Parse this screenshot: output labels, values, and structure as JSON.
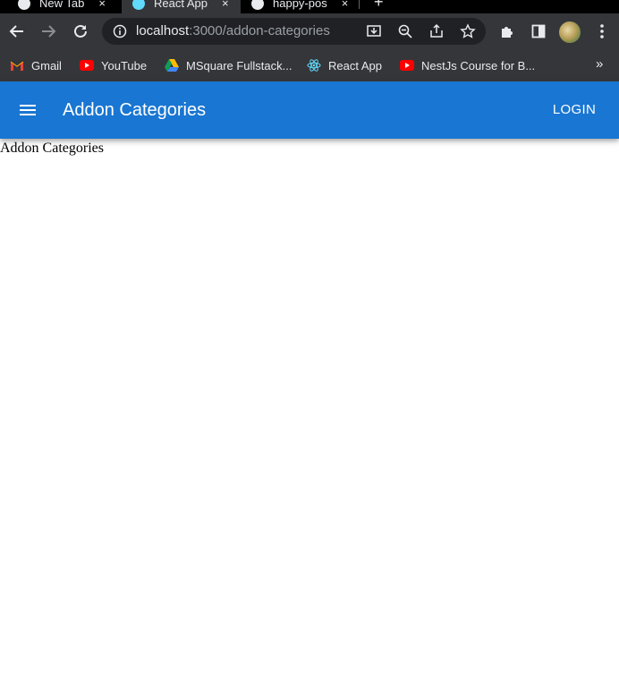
{
  "browser": {
    "tabs": [
      {
        "label": "New Tab",
        "icon": "github-icon",
        "close": "×"
      },
      {
        "label": "React App",
        "icon": "react-icon",
        "close": "×"
      },
      {
        "label": "happy-pos",
        "icon": "github-icon",
        "close": "×"
      }
    ],
    "new_tab": "+",
    "address": {
      "host": "localhost",
      "path": ":3000/addon-categories"
    },
    "bookmarks": [
      {
        "label": "Gmail",
        "icon": "gmail-icon"
      },
      {
        "label": "YouTube",
        "icon": "youtube-icon"
      },
      {
        "label": "MSquare Fullstack...",
        "icon": "google-drive-icon"
      },
      {
        "label": "React App",
        "icon": "react-icon"
      },
      {
        "label": "NestJs Course for B...",
        "icon": "youtube-icon"
      }
    ],
    "bookmarks_more": "»"
  },
  "appbar": {
    "title": "Addon Categories",
    "login_label": "LOGIN",
    "color": "#1976d2"
  },
  "content": {
    "text": "Addon Categories"
  }
}
